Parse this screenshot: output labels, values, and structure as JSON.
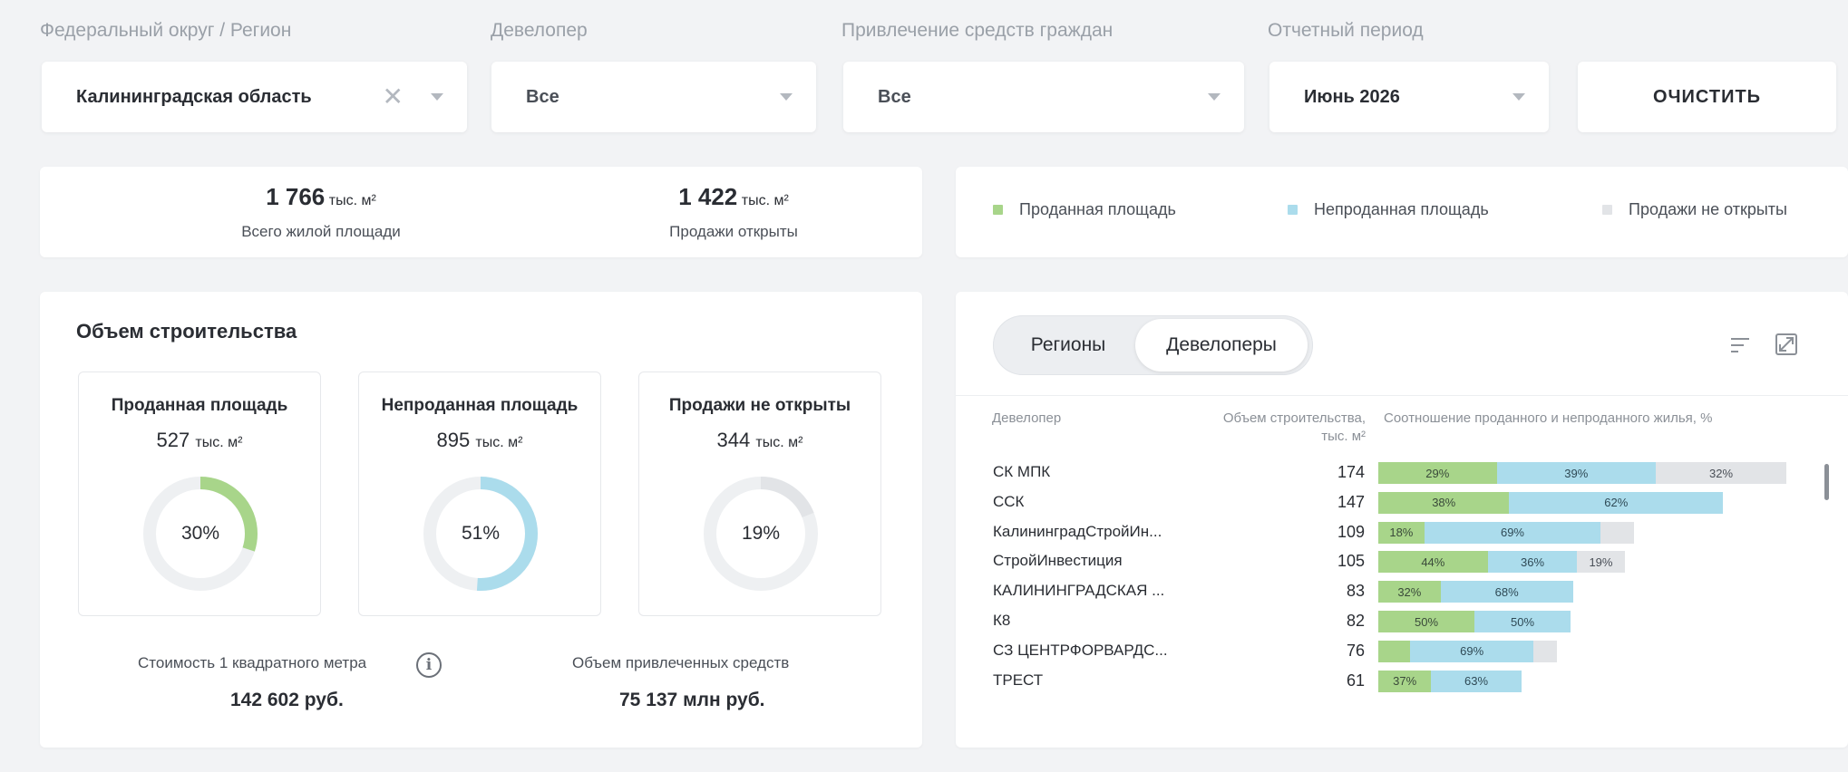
{
  "filters": {
    "region": {
      "label": "Федеральный округ / Регион",
      "value": "Калининградская область"
    },
    "developer": {
      "label": "Девелопер",
      "value": "Все"
    },
    "funds": {
      "label": "Привлечение средств граждан",
      "value": "Все"
    },
    "period": {
      "label": "Отчетный период",
      "value": "Июнь 2026"
    },
    "clear_label": "ОЧИСТИТЬ"
  },
  "summary": {
    "total": {
      "value": "1 766",
      "unit": "тыс. м²",
      "caption": "Всего жилой площади"
    },
    "open": {
      "value": "1 422",
      "unit": "тыс. м²",
      "caption": "Продажи открыты"
    }
  },
  "legend": {
    "sold": "Проданная площадь",
    "unsold": "Непроданная площадь",
    "closed": "Продажи не открыты"
  },
  "colors": {
    "sold": "#a8d58a",
    "unsold": "#abdcec",
    "closed": "#e2e4e7",
    "track": "#eef0f2"
  },
  "volume": {
    "title": "Объем строительства",
    "cards": [
      {
        "title": "Проданная площадь",
        "value": "527",
        "unit": "тыс. м²",
        "percent": "30%",
        "fraction": 0.3,
        "color": "#a8d58a"
      },
      {
        "title": "Непроданная площадь",
        "value": "895",
        "unit": "тыс. м²",
        "percent": "51%",
        "fraction": 0.51,
        "color": "#abdcec"
      },
      {
        "title": "Продажи не открыты",
        "value": "344",
        "unit": "тыс. м²",
        "percent": "19%",
        "fraction": 0.19,
        "color": "#e2e4e7"
      }
    ],
    "price_caption": "Стоимость 1 квадратного метра",
    "price_value": "142 602 руб.",
    "funds_caption": "Объем привлеченных средств",
    "funds_value": "75 137 млн руб."
  },
  "table": {
    "tabs": [
      "Регионы",
      "Девелоперы"
    ],
    "active_tab": 1,
    "headers": {
      "developer": "Девелопер",
      "volume_line1": "Объем строительства,",
      "volume_line2": "тыс. м²",
      "ratio": "Соотношение проданного и непроданного жилья, %"
    },
    "rows": [
      {
        "name": "СК МПК",
        "volume": "174",
        "sold": 29,
        "unsold": 39,
        "closed": 32,
        "sold_label": "29%",
        "unsold_label": "39%",
        "closed_label": "32%"
      },
      {
        "name": "ССК",
        "volume": "147",
        "sold": 38,
        "unsold": 62,
        "closed": 0,
        "sold_label": "38%",
        "unsold_label": "62%",
        "closed_label": ""
      },
      {
        "name": "КалининградСтройИн...",
        "volume": "109",
        "sold": 18,
        "unsold": 69,
        "closed": 13,
        "sold_label": "18%",
        "unsold_label": "69%",
        "closed_label": ""
      },
      {
        "name": "СтройИнвестиция",
        "volume": "105",
        "sold": 44,
        "unsold": 36,
        "closed": 19,
        "sold_label": "44%",
        "unsold_label": "36%",
        "closed_label": "19%"
      },
      {
        "name": "КАЛИНИНГРАДСКАЯ ...",
        "volume": "83",
        "sold": 32,
        "unsold": 68,
        "closed": 0,
        "sold_label": "32%",
        "unsold_label": "68%",
        "closed_label": ""
      },
      {
        "name": "К8",
        "volume": "82",
        "sold": 50,
        "unsold": 50,
        "closed": 0,
        "sold_label": "50%",
        "unsold_label": "50%",
        "closed_label": ""
      },
      {
        "name": "СЗ ЦЕНТРФОРВАРДС...",
        "volume": "76",
        "sold": 18,
        "unsold": 69,
        "closed": 13,
        "sold_label": "",
        "unsold_label": "69%",
        "closed_label": ""
      },
      {
        "name": "ТРЕСТ",
        "volume": "61",
        "sold": 37,
        "unsold": 63,
        "closed": 0,
        "sold_label": "37%",
        "unsold_label": "63%",
        "closed_label": ""
      }
    ]
  }
}
